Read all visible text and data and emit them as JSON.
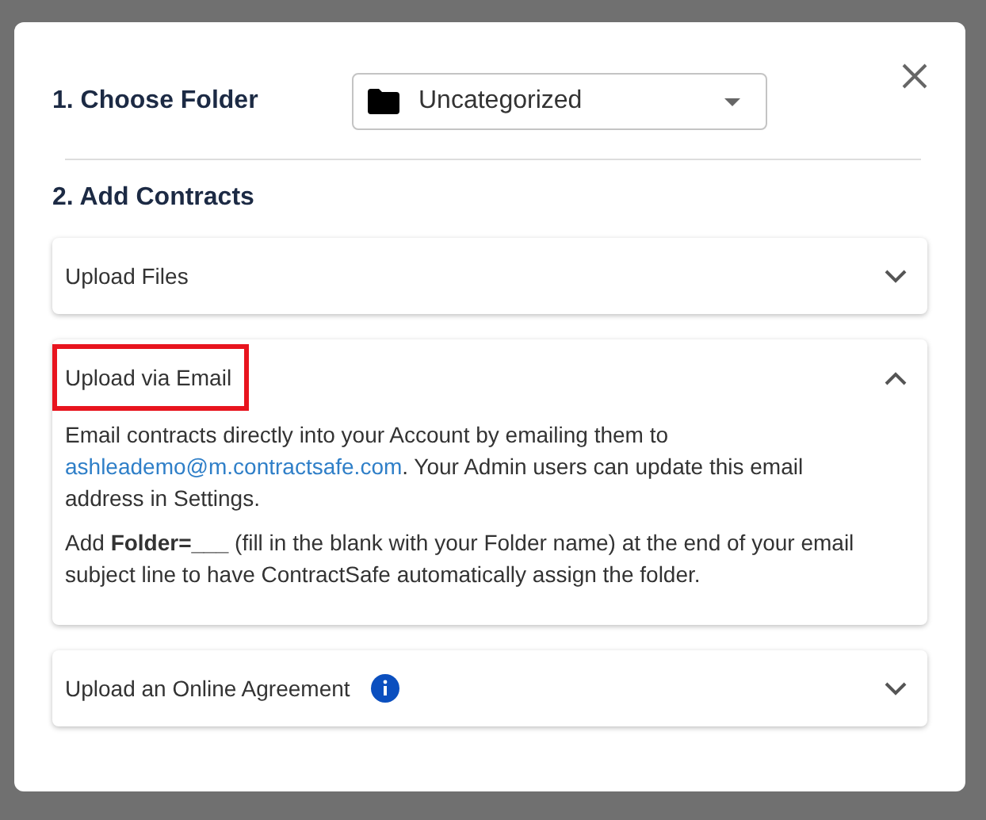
{
  "folder": {
    "label": "1. Choose Folder",
    "value": "Uncategorized"
  },
  "add_contracts": {
    "label": "2. Add Contracts"
  },
  "sections": [
    {
      "title": "Upload Files",
      "expanded": false,
      "highlighted": false,
      "info": false
    },
    {
      "title": "Upload via Email",
      "expanded": true,
      "highlighted": true,
      "info": false,
      "body": [
        {
          "kind": "link",
          "before": "Email contracts directly into your Account by emailing them to ",
          "link": "ashleademo@m.contractsafe.com",
          "after": ". Your Admin users can update this email address in Settings."
        },
        {
          "kind": "text",
          "text": "Add **Folder=___** (fill in the blank with your Folder name) at the end of your email subject line to have ContractSafe automatically assign the folder."
        }
      ]
    },
    {
      "title": "Upload an Online Agreement",
      "expanded": false,
      "highlighted": false,
      "info": true
    }
  ]
}
